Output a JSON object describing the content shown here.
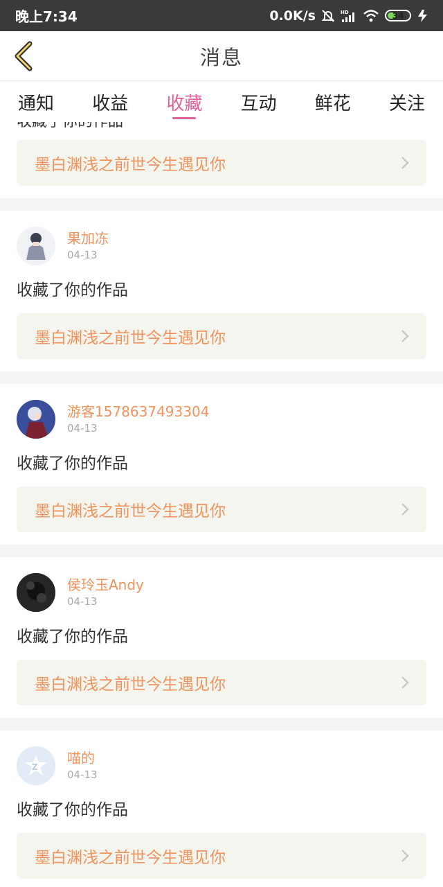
{
  "status_bar": {
    "time": "晚上7:34",
    "network_speed": "0.0K/s",
    "battery": "34",
    "icons": [
      "mute-bell-icon",
      "hd-signal-icon",
      "wifi-icon",
      "battery-icon",
      "charging-icon"
    ]
  },
  "header": {
    "title": "消息",
    "back_icon": "chevron-left-icon"
  },
  "tabs": [
    {
      "label": "通知",
      "active": false
    },
    {
      "label": "收益",
      "active": false
    },
    {
      "label": "收藏",
      "active": true
    },
    {
      "label": "互动",
      "active": false
    },
    {
      "label": "鲜花",
      "active": false
    },
    {
      "label": "关注",
      "active": false
    }
  ],
  "partial_card": {
    "action": "收藏了你的作品",
    "work_title": "墨白渊浅之前世今生遇见你"
  },
  "messages": [
    {
      "username": "果加冻",
      "date": "04-13",
      "action": "收藏了你的作品",
      "work_title": "墨白渊浅之前世今生遇见你",
      "avatar": "anime-girl-avatar"
    },
    {
      "username": "游客1578637493304",
      "date": "04-13",
      "action": "收藏了你的作品",
      "work_title": "墨白渊浅之前世今生遇见你",
      "avatar": "anime-character-avatar"
    },
    {
      "username": "侯玲玉Andy",
      "date": "04-13",
      "action": "收藏了你的作品",
      "work_title": "墨白渊浅之前世今生遇见你",
      "avatar": "dark-photo-avatar"
    },
    {
      "username": "喵的",
      "date": "04-13",
      "action": "收藏了你的作品",
      "work_title": "墨白渊浅之前世今生遇见你",
      "avatar": "qq-default-avatar"
    }
  ],
  "colors": {
    "accent_pink": "#e0609a",
    "username_orange": "#f0935c",
    "work_box_bg": "#f5f5ef",
    "status_bar_bg": "#3a3a3a"
  }
}
